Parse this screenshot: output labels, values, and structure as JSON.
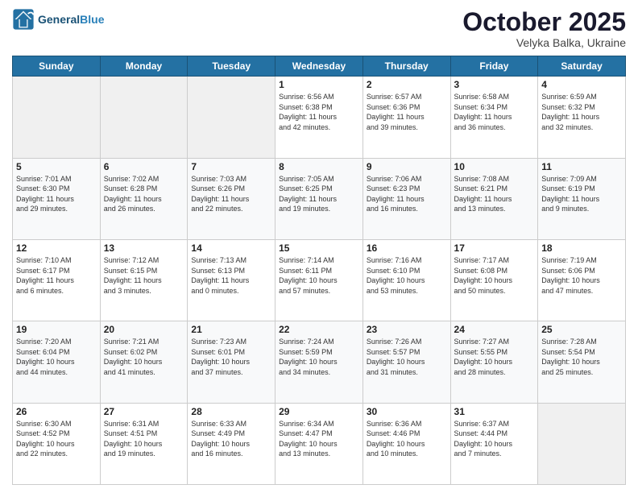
{
  "header": {
    "logo_line1": "General",
    "logo_line2": "Blue",
    "month": "October 2025",
    "location": "Velyka Balka, Ukraine"
  },
  "days_of_week": [
    "Sunday",
    "Monday",
    "Tuesday",
    "Wednesday",
    "Thursday",
    "Friday",
    "Saturday"
  ],
  "weeks": [
    [
      {
        "day": "",
        "info": ""
      },
      {
        "day": "",
        "info": ""
      },
      {
        "day": "",
        "info": ""
      },
      {
        "day": "1",
        "info": "Sunrise: 6:56 AM\nSunset: 6:38 PM\nDaylight: 11 hours\nand 42 minutes."
      },
      {
        "day": "2",
        "info": "Sunrise: 6:57 AM\nSunset: 6:36 PM\nDaylight: 11 hours\nand 39 minutes."
      },
      {
        "day": "3",
        "info": "Sunrise: 6:58 AM\nSunset: 6:34 PM\nDaylight: 11 hours\nand 36 minutes."
      },
      {
        "day": "4",
        "info": "Sunrise: 6:59 AM\nSunset: 6:32 PM\nDaylight: 11 hours\nand 32 minutes."
      }
    ],
    [
      {
        "day": "5",
        "info": "Sunrise: 7:01 AM\nSunset: 6:30 PM\nDaylight: 11 hours\nand 29 minutes."
      },
      {
        "day": "6",
        "info": "Sunrise: 7:02 AM\nSunset: 6:28 PM\nDaylight: 11 hours\nand 26 minutes."
      },
      {
        "day": "7",
        "info": "Sunrise: 7:03 AM\nSunset: 6:26 PM\nDaylight: 11 hours\nand 22 minutes."
      },
      {
        "day": "8",
        "info": "Sunrise: 7:05 AM\nSunset: 6:25 PM\nDaylight: 11 hours\nand 19 minutes."
      },
      {
        "day": "9",
        "info": "Sunrise: 7:06 AM\nSunset: 6:23 PM\nDaylight: 11 hours\nand 16 minutes."
      },
      {
        "day": "10",
        "info": "Sunrise: 7:08 AM\nSunset: 6:21 PM\nDaylight: 11 hours\nand 13 minutes."
      },
      {
        "day": "11",
        "info": "Sunrise: 7:09 AM\nSunset: 6:19 PM\nDaylight: 11 hours\nand 9 minutes."
      }
    ],
    [
      {
        "day": "12",
        "info": "Sunrise: 7:10 AM\nSunset: 6:17 PM\nDaylight: 11 hours\nand 6 minutes."
      },
      {
        "day": "13",
        "info": "Sunrise: 7:12 AM\nSunset: 6:15 PM\nDaylight: 11 hours\nand 3 minutes."
      },
      {
        "day": "14",
        "info": "Sunrise: 7:13 AM\nSunset: 6:13 PM\nDaylight: 11 hours\nand 0 minutes."
      },
      {
        "day": "15",
        "info": "Sunrise: 7:14 AM\nSunset: 6:11 PM\nDaylight: 10 hours\nand 57 minutes."
      },
      {
        "day": "16",
        "info": "Sunrise: 7:16 AM\nSunset: 6:10 PM\nDaylight: 10 hours\nand 53 minutes."
      },
      {
        "day": "17",
        "info": "Sunrise: 7:17 AM\nSunset: 6:08 PM\nDaylight: 10 hours\nand 50 minutes."
      },
      {
        "day": "18",
        "info": "Sunrise: 7:19 AM\nSunset: 6:06 PM\nDaylight: 10 hours\nand 47 minutes."
      }
    ],
    [
      {
        "day": "19",
        "info": "Sunrise: 7:20 AM\nSunset: 6:04 PM\nDaylight: 10 hours\nand 44 minutes."
      },
      {
        "day": "20",
        "info": "Sunrise: 7:21 AM\nSunset: 6:02 PM\nDaylight: 10 hours\nand 41 minutes."
      },
      {
        "day": "21",
        "info": "Sunrise: 7:23 AM\nSunset: 6:01 PM\nDaylight: 10 hours\nand 37 minutes."
      },
      {
        "day": "22",
        "info": "Sunrise: 7:24 AM\nSunset: 5:59 PM\nDaylight: 10 hours\nand 34 minutes."
      },
      {
        "day": "23",
        "info": "Sunrise: 7:26 AM\nSunset: 5:57 PM\nDaylight: 10 hours\nand 31 minutes."
      },
      {
        "day": "24",
        "info": "Sunrise: 7:27 AM\nSunset: 5:55 PM\nDaylight: 10 hours\nand 28 minutes."
      },
      {
        "day": "25",
        "info": "Sunrise: 7:28 AM\nSunset: 5:54 PM\nDaylight: 10 hours\nand 25 minutes."
      }
    ],
    [
      {
        "day": "26",
        "info": "Sunrise: 6:30 AM\nSunset: 4:52 PM\nDaylight: 10 hours\nand 22 minutes."
      },
      {
        "day": "27",
        "info": "Sunrise: 6:31 AM\nSunset: 4:51 PM\nDaylight: 10 hours\nand 19 minutes."
      },
      {
        "day": "28",
        "info": "Sunrise: 6:33 AM\nSunset: 4:49 PM\nDaylight: 10 hours\nand 16 minutes."
      },
      {
        "day": "29",
        "info": "Sunrise: 6:34 AM\nSunset: 4:47 PM\nDaylight: 10 hours\nand 13 minutes."
      },
      {
        "day": "30",
        "info": "Sunrise: 6:36 AM\nSunset: 4:46 PM\nDaylight: 10 hours\nand 10 minutes."
      },
      {
        "day": "31",
        "info": "Sunrise: 6:37 AM\nSunset: 4:44 PM\nDaylight: 10 hours\nand 7 minutes."
      },
      {
        "day": "",
        "info": ""
      }
    ]
  ]
}
